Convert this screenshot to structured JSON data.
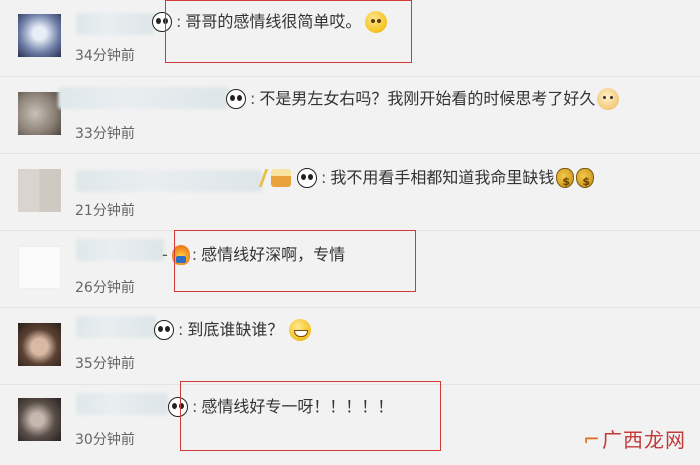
{
  "comments": [
    {
      "text": "哥哥的感情线很简单哎。",
      "time": "34分钟前",
      "emojis": [
        "smile-emoji"
      ]
    },
    {
      "text": "不是男左女右吗？我刚开始看的时候思考了好久",
      "time": "33分钟前",
      "emojis": [
        "panda-emoji",
        "dog-emoji"
      ]
    },
    {
      "text": "我不用看手相都知道我命里缺钱",
      "time": "21分钟前",
      "emojis": [
        "cake-emoji",
        "panda-emoji",
        "money-bag-emoji",
        "money-bag-emoji"
      ]
    },
    {
      "text": "感情线好深啊，专情",
      "time": "26分钟前",
      "emojis": [
        "fire-emoji"
      ]
    },
    {
      "text": "到底谁缺谁？",
      "time": "35分钟前",
      "emojis": [
        "panda-emoji",
        "grin-emoji"
      ]
    },
    {
      "text": "感情线好专一呀！！！！！",
      "time": "30分钟前",
      "emojis": [
        "panda-emoji"
      ]
    }
  ],
  "separator": ":",
  "watermark": {
    "text": "广西龙网"
  },
  "colors": {
    "highlight_box": "#d23a3a",
    "background": "#f2f2f2",
    "divider": "#e4e4e4"
  }
}
